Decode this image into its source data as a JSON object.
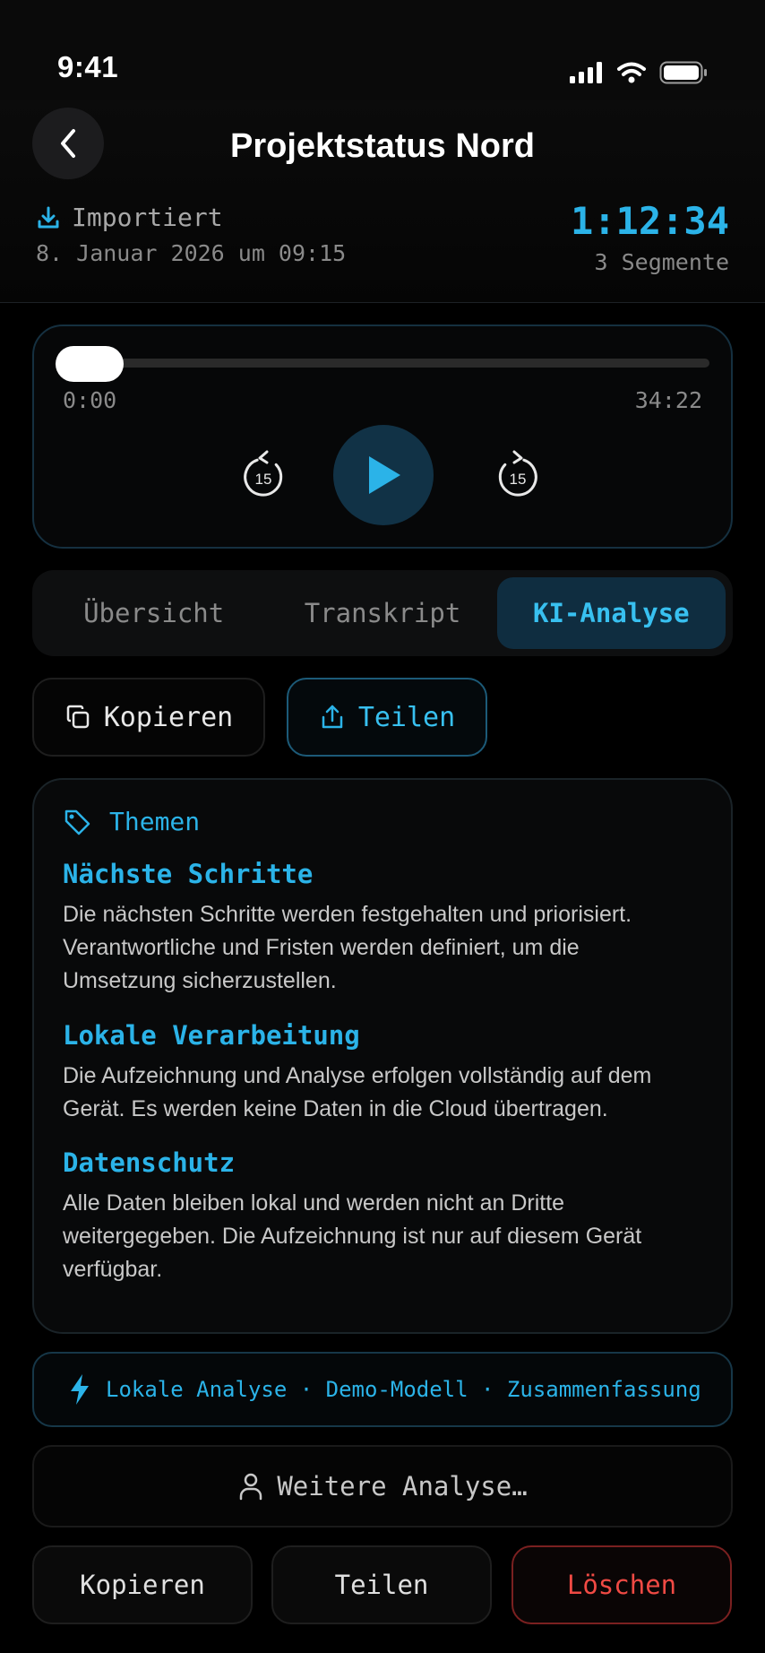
{
  "status_bar": {
    "time": "9:41"
  },
  "header": {
    "title": "Projektstatus Nord",
    "import_label": "Importiert",
    "import_date": "8. Januar 2026 um 09:15",
    "duration": "1:12:34",
    "segments": "3 Segmente"
  },
  "player": {
    "current_time": "0:00",
    "total_time": "34:22",
    "progress": 0,
    "skip_back_label": "15",
    "skip_forward_label": "15"
  },
  "tabs": [
    {
      "label": "Übersicht",
      "active": false
    },
    {
      "label": "Transkript",
      "active": false
    },
    {
      "label": "KI-Analyse",
      "active": true
    }
  ],
  "actions": {
    "copy_label": "Kopieren",
    "share_label": "Teilen"
  },
  "themes": {
    "header": "Themen",
    "topics": [
      {
        "title": "Nächste Schritte",
        "lines": [
          "Die nächsten Schritte werden festgehalten und priorisiert.",
          "Verantwortliche und Fristen werden definiert, um die",
          "Umsetzung sicherzustellen."
        ]
      },
      {
        "title": "Lokale Verarbeitung",
        "lines": [
          "Die Aufzeichnung und Analyse erfolgen vollständig auf dem",
          "Gerät. Es werden keine Daten in die Cloud übertragen."
        ]
      },
      {
        "title": "Datenschutz",
        "lines": [
          "Alle Daten bleiben lokal und werden nicht an Dritte",
          "weitergegeben. Die Aufzeichnung ist nur auf diesem Gerät",
          "verfügbar."
        ]
      }
    ]
  },
  "info_pill": {
    "text": "Lokale Analyse · Demo-Modell · Zusammenfassung"
  },
  "more_analysis": {
    "label": "Weitere Analyse…"
  },
  "bottom": {
    "copy_label": "Kopieren",
    "share_label": "Teilen",
    "delete_label": "Löschen"
  },
  "colors": {
    "accent": "#2bb3e8",
    "danger": "#f04a44",
    "background": "#000000"
  },
  "icons": [
    "signal-icon",
    "wifi-icon",
    "battery-icon",
    "back-chevron-icon",
    "download-icon",
    "play-icon",
    "skip-back-15-icon",
    "skip-forward-15-icon",
    "copy-icon",
    "share-icon",
    "tag-icon",
    "bolt-icon",
    "person-icon"
  ]
}
